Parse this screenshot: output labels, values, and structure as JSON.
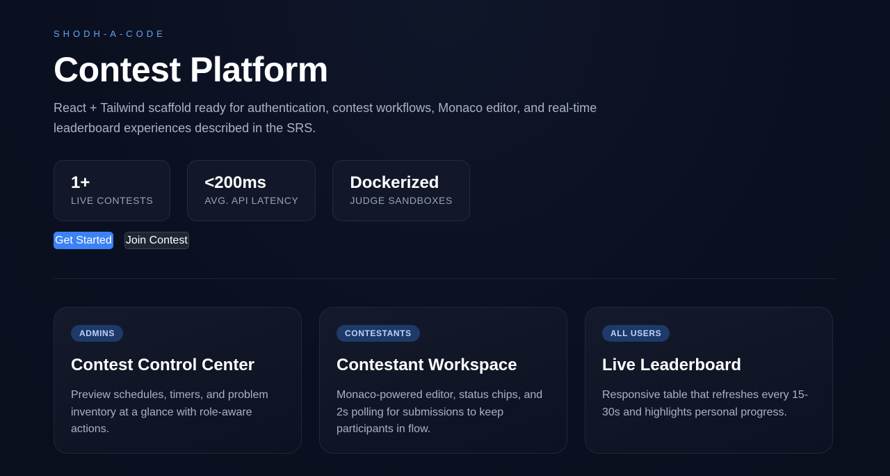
{
  "hero": {
    "eyebrow": "SHODH-A-CODE",
    "title": "Contest Platform",
    "subtitle": "React + Tailwind scaffold ready for authentication, contest workflows, Monaco editor, and real-time leaderboard experiences described in the SRS."
  },
  "stats": [
    {
      "value": "1+",
      "label": "Live contests"
    },
    {
      "value": "<200ms",
      "label": "Avg. API latency"
    },
    {
      "value": "Dockerized",
      "label": "Judge sandboxes"
    }
  ],
  "actions": {
    "primary_label": "Get Started",
    "secondary_label": "Join Contest"
  },
  "cards": [
    {
      "badge": "ADMINS",
      "title": "Contest Control Center",
      "body": "Preview schedules, timers, and problem inventory at a glance with role-aware actions."
    },
    {
      "badge": "CONTESTANTS",
      "title": "Contestant Workspace",
      "body": "Monaco-powered editor, status chips, and 2s polling for submissions to keep participants in flow."
    },
    {
      "badge": "ALL USERS",
      "title": "Live Leaderboard",
      "body": "Responsive table that refreshes every 15-30s and highlights personal progress."
    }
  ],
  "colors": {
    "background": "#0b1020",
    "accent": "#3b82f6",
    "eyebrow": "#60a5fa",
    "badge_bg": "#1e3a68"
  }
}
